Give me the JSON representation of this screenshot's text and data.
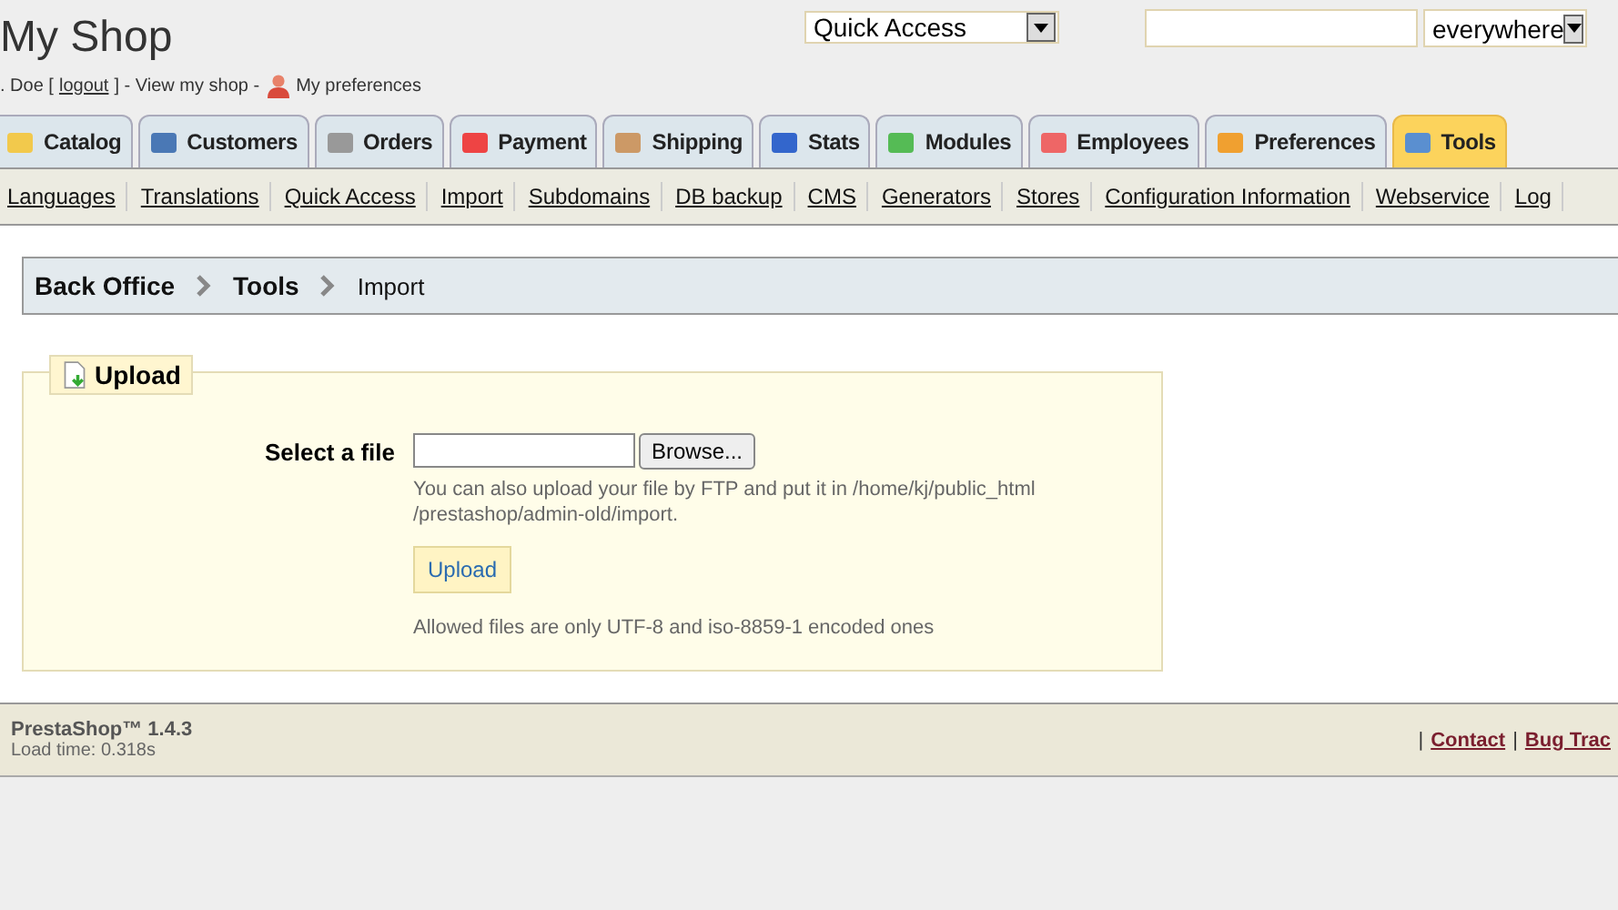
{
  "header": {
    "shop_title": "My Shop",
    "quick_access": {
      "value": "Quick Access"
    },
    "search": {
      "scope": "everywhere"
    },
    "user_line": [
      {
        "kind": "text",
        "text": ". Doe ["
      },
      {
        "kind": "link",
        "text": "logout"
      },
      {
        "kind": "text",
        "text": "] - View my shop -"
      },
      {
        "kind": "icon"
      },
      {
        "kind": "plain",
        "text": "My preferences"
      }
    ]
  },
  "tabs": [
    {
      "label": "Catalog",
      "selected": false
    },
    {
      "label": "Customers",
      "selected": false
    },
    {
      "label": "Orders",
      "selected": false
    },
    {
      "label": "Payment",
      "selected": false
    },
    {
      "label": "Shipping",
      "selected": false
    },
    {
      "label": "Stats",
      "selected": false
    },
    {
      "label": "Modules",
      "selected": false
    },
    {
      "label": "Employees",
      "selected": false
    },
    {
      "label": "Preferences",
      "selected": false
    },
    {
      "label": "Tools",
      "selected": true
    }
  ],
  "subtabs": [
    "Languages",
    "Translations",
    "Quick Access",
    "Import",
    "Subdomains",
    "DB backup",
    "CMS",
    "Generators",
    "Stores",
    "Configuration Information",
    "Webservice",
    "Log"
  ],
  "breadcrumb": [
    {
      "label": "Back Office",
      "current": false
    },
    {
      "label": "Tools",
      "current": false
    },
    {
      "label": "Import",
      "current": true
    }
  ],
  "upload_panel": {
    "legend": "Upload",
    "field_label": "Select a file",
    "browse_button": "Browse...",
    "help": [
      "You can also upload your file by FTP and put it in /home/kj/public_html",
      "/prestashop/admin-old/import."
    ],
    "submit_button": "Upload",
    "note": "Allowed files are only UTF-8 and iso-8859-1 encoded ones"
  },
  "footer": {
    "version": "PrestaShop™ 1.4.3",
    "load_time": "Load time: 0.318s",
    "links": [
      {
        "kind": "separator",
        "text": "|"
      },
      {
        "kind": "link",
        "text": "Contact"
      },
      {
        "kind": "separator",
        "text": "|"
      },
      {
        "kind": "link",
        "text": "Bug Trac"
      }
    ]
  }
}
